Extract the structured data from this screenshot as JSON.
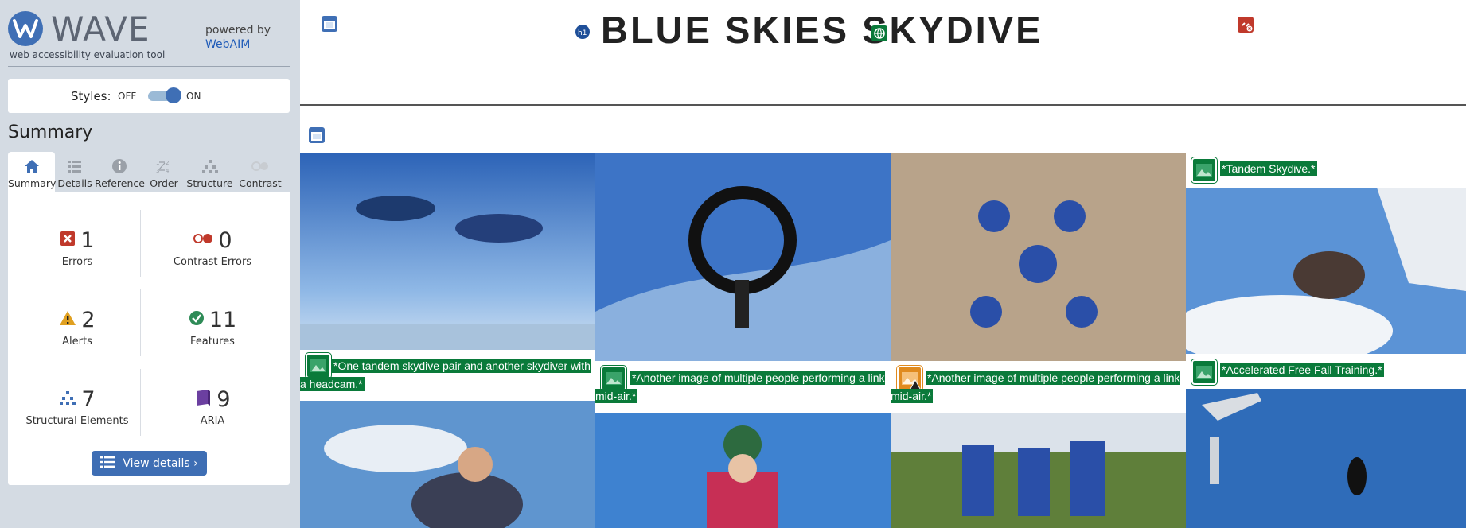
{
  "wave": {
    "logo_text": "WAVE",
    "tagline": "web accessibility evaluation tool",
    "powered_by": "powered by",
    "webaim_link": "WebAIM",
    "styles": {
      "label": "Styles:",
      "off": "OFF",
      "on": "ON",
      "state": "on"
    },
    "summary_heading": "Summary",
    "tabs": [
      {
        "label": "Summary",
        "icon": "home-icon",
        "active": true
      },
      {
        "label": "Details",
        "icon": "list-icon",
        "active": false
      },
      {
        "label": "Reference",
        "icon": "info-icon",
        "active": false
      },
      {
        "label": "Order",
        "icon": "order-icon",
        "active": false
      },
      {
        "label": "Structure",
        "icon": "structure-icon",
        "active": false
      },
      {
        "label": "Contrast",
        "icon": "contrast-icon",
        "active": false
      }
    ],
    "stats": [
      {
        "count": "1",
        "label": "Errors",
        "icon": "error-icon",
        "color": "#c0392b"
      },
      {
        "count": "0",
        "label": "Contrast Errors",
        "icon": "contrast-error-icon",
        "color": "#c0392b"
      },
      {
        "count": "2",
        "label": "Alerts",
        "icon": "alert-icon",
        "color": "#e0a020"
      },
      {
        "count": "11",
        "label": "Features",
        "icon": "feature-check-icon",
        "color": "#2e8b57"
      },
      {
        "count": "7",
        "label": "Structural Elements",
        "icon": "structure-icon",
        "color": "#3f6fb5"
      },
      {
        "count": "9",
        "label": "ARIA",
        "icon": "aria-icon",
        "color": "#6b3fa0"
      }
    ],
    "view_details": "View details ›"
  },
  "page": {
    "title": "BLUE SKIES SKYDIVE",
    "captions": [
      "*One tandem skydive pair and another skydiver with a headcam.*",
      "*Another image of multiple people performing a link mid-air.*",
      "*Another image of multiple people performing a link mid-air.*",
      "*Tandem Skydive.*",
      "*Accelerated Free Fall Training.*"
    ]
  },
  "colors": {
    "wave_blue": "#3f6fb5",
    "sidebar_bg": "#d4dbe3",
    "feature_green": "#0a7a3a",
    "alert_orange": "#e08a1e",
    "error_red": "#c0392b"
  }
}
